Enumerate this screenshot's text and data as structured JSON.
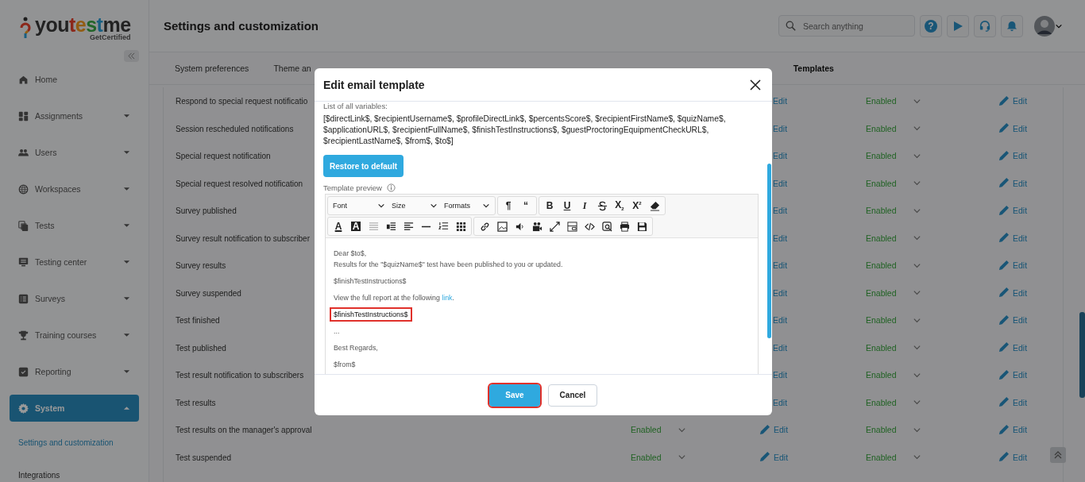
{
  "sidebar": {
    "logo": {
      "word": [
        "you",
        "t",
        "e",
        "s",
        "t",
        "me"
      ],
      "tagline": "GetCertified"
    },
    "items": [
      {
        "label": "Home",
        "kind": "link",
        "selected": false
      },
      {
        "label": "Assignments",
        "kind": "group",
        "expanded": false,
        "selected": false
      },
      {
        "label": "Users",
        "kind": "group",
        "expanded": false,
        "selected": false
      },
      {
        "label": "Workspaces",
        "kind": "group",
        "expanded": false,
        "selected": false
      },
      {
        "label": "Tests",
        "kind": "group",
        "expanded": false,
        "selected": false
      },
      {
        "label": "Testing center",
        "kind": "group",
        "expanded": false,
        "selected": false
      },
      {
        "label": "Surveys",
        "kind": "group",
        "expanded": false,
        "selected": false
      },
      {
        "label": "Training courses",
        "kind": "group",
        "expanded": false,
        "selected": false
      },
      {
        "label": "Reporting",
        "kind": "group",
        "expanded": false,
        "selected": false
      },
      {
        "label": "System",
        "kind": "group",
        "expanded": true,
        "selected": true,
        "children": [
          {
            "label": "Settings and customization",
            "selected": true
          },
          {
            "label": "Integrations",
            "selected": false
          }
        ]
      }
    ]
  },
  "header": {
    "title": "Settings and customization",
    "search": {
      "placeholder": "Search anything"
    },
    "help_label": "?"
  },
  "tabs": [
    {
      "label": "System preferences",
      "selected": false
    },
    {
      "label": "Theme an",
      "selected": false
    },
    {
      "label": "Templates",
      "selected": true
    }
  ],
  "table": {
    "rows": [
      {
        "name": "Respond to special request notificatio",
        "edit_1": "Edit",
        "status_2": "Enabled",
        "edit_2": "Edit"
      },
      {
        "name": "Session rescheduled notifications",
        "edit_1": "Edit",
        "status_2": "Enabled",
        "edit_2": "Edit"
      },
      {
        "name": "Special request notification",
        "edit_1": "Edit",
        "status_2": "Enabled",
        "edit_2": "Edit"
      },
      {
        "name": "Special request resolved notification",
        "edit_1": "Edit",
        "status_2": "Enabled",
        "edit_2": "Edit"
      },
      {
        "name": "Survey published",
        "edit_1": "Edit",
        "status_2": "Enabled",
        "edit_2": "Edit"
      },
      {
        "name": "Survey result notification to subscriber",
        "edit_1": "Edit",
        "status_2": "Enabled",
        "edit_2": "Edit"
      },
      {
        "name": "Survey results",
        "edit_1": "Edit",
        "status_2": "Enabled",
        "edit_2": "Edit"
      },
      {
        "name": "Survey suspended",
        "edit_1": "Edit",
        "status_2": "Enabled",
        "edit_2": "Edit"
      },
      {
        "name": "Test finished",
        "edit_1": "Edit",
        "status_2": "Enabled",
        "edit_2": "Edit"
      },
      {
        "name": "Test published",
        "edit_1": "Edit",
        "status_2": "Enabled",
        "edit_2": "Edit"
      },
      {
        "name": "Test result notification to subscribers",
        "edit_1": "Edit",
        "status_2": "Enabled",
        "edit_2": "Edit"
      },
      {
        "name": "Test results",
        "edit_1": "Edit",
        "status_2": "Enabled",
        "edit_2": "Edit"
      },
      {
        "name": "Test results on the manager's approval",
        "status_1": "Enabled",
        "edit_1": "Edit",
        "status_2": "Enabled",
        "edit_2": "Edit"
      },
      {
        "name": "Test suspended",
        "status_1": "Enabled",
        "edit_1": "Edit",
        "status_2": "Enabled",
        "edit_2": "Edit"
      }
    ]
  },
  "modal": {
    "title": "Edit email template",
    "variables_label": "List of all variables:",
    "variables": "[$directLink$, $recipientUsername$, $profileDirectLink$, $percentsScore$, $recipientFirstName$, $quizName$, $applicationURL$, $recipientFullName$, $finishTestInstructions$, $guestProctoringEquipmentCheckURL$, $recipientLastName$, $from$, $to$]",
    "restore_button": "Restore to default",
    "preview_label": "Template preview",
    "editor": {
      "dropdowns": [
        "Font",
        "Size",
        "Formats"
      ],
      "block_buttons": [
        "¶",
        "“"
      ],
      "style_buttons": [
        "B",
        "U",
        "I",
        "X$_{2}$",
        "X$^{2}$"
      ],
      "color_buttons": [
        "A",
        "A"
      ],
      "content": [
        {
          "kind": "text",
          "lines": [
            "Dear $to$,",
            "Results for the \"$quizName$\" test have been published to you or updated."
          ],
          "highlighted": false
        },
        {
          "kind": "text",
          "lines": [
            "$finishTestInstructions$"
          ],
          "highlighted": false
        },
        {
          "kind": "link_text",
          "lines": [
            "View the full report at the following "
          ],
          "link": "link",
          "after": ".",
          "highlighted": false
        },
        {
          "kind": "text",
          "lines": [
            "$finishTestInstructions$"
          ],
          "highlighted": true
        },
        {
          "kind": "text",
          "lines": [
            "..."
          ],
          "highlighted": false
        },
        {
          "kind": "text",
          "lines": [
            "Best Regards,"
          ],
          "highlighted": false
        },
        {
          "kind": "text",
          "lines": [
            "$from$"
          ],
          "highlighted": false
        }
      ]
    },
    "buttons": [
      {
        "label": "Save",
        "kind": "primary",
        "highlighted": true
      },
      {
        "label": "Cancel",
        "kind": "secondary",
        "highlighted": false
      }
    ]
  }
}
